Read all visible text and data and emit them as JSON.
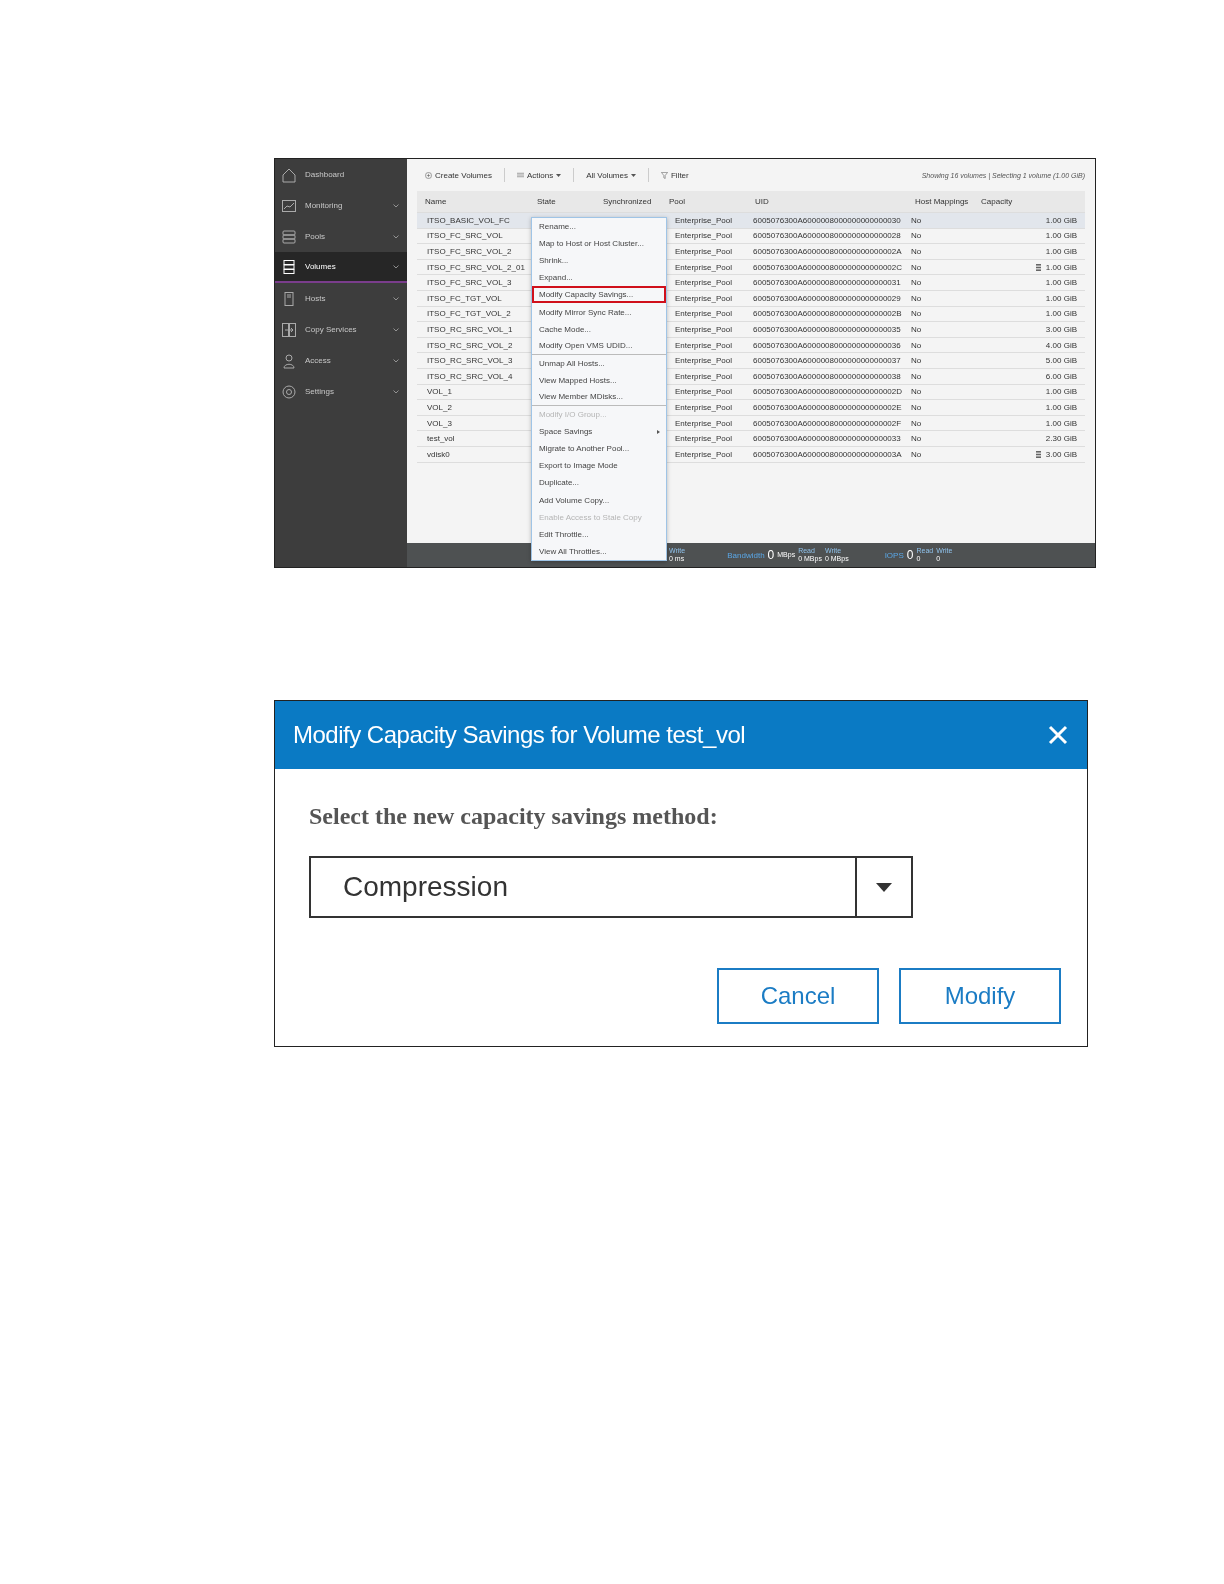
{
  "volumes_screen": {
    "sidebar": {
      "items": [
        {
          "label": "Dashboard",
          "selected": false,
          "expandable": false
        },
        {
          "label": "Monitoring",
          "selected": false,
          "expandable": true
        },
        {
          "label": "Pools",
          "selected": false,
          "expandable": true
        },
        {
          "label": "Volumes",
          "selected": true,
          "expandable": true
        },
        {
          "label": "Hosts",
          "selected": false,
          "expandable": true
        },
        {
          "label": "Copy Services",
          "selected": false,
          "expandable": true
        },
        {
          "label": "Access",
          "selected": false,
          "expandable": true
        },
        {
          "label": "Settings",
          "selected": false,
          "expandable": true
        }
      ]
    },
    "toolbar": {
      "create": "Create Volumes",
      "actions": "Actions",
      "filter_menu": "All Volumes",
      "filter": "Filter",
      "summary": "Showing 16 volumes | Selecting 1 volume (1.00 GiB)"
    },
    "table": {
      "columns": [
        "Name",
        "State",
        "Synchronized",
        "Pool",
        "UID",
        "Host Mappings",
        "Capacity"
      ],
      "rows": [
        {
          "name": "ITSO_BASIC_VOL_FC",
          "pool": "Enterprise_Pool",
          "uid": "6005076300A6000008000000000000030",
          "host_mappings": "No",
          "capacity": "1.00 GiB",
          "selected": true,
          "multi_copy": false
        },
        {
          "name": "ITSO_FC_SRC_VOL",
          "pool": "Enterprise_Pool",
          "uid": "6005076300A6000008000000000000028",
          "host_mappings": "No",
          "capacity": "1.00 GiB",
          "selected": false,
          "multi_copy": false
        },
        {
          "name": "ITSO_FC_SRC_VOL_2",
          "pool": "Enterprise_Pool",
          "uid": "6005076300A600000800000000000002A",
          "host_mappings": "No",
          "capacity": "1.00 GiB",
          "selected": false,
          "multi_copy": false
        },
        {
          "name": "ITSO_FC_SRC_VOL_2_01",
          "pool": "Enterprise_Pool",
          "uid": "6005076300A600000800000000000002C",
          "host_mappings": "No",
          "capacity": "1.00 GiB",
          "selected": false,
          "multi_copy": true
        },
        {
          "name": "ITSO_FC_SRC_VOL_3",
          "pool": "Enterprise_Pool",
          "uid": "6005076300A6000008000000000000031",
          "host_mappings": "No",
          "capacity": "1.00 GiB",
          "selected": false,
          "multi_copy": false
        },
        {
          "name": "ITSO_FC_TGT_VOL",
          "pool": "Enterprise_Pool",
          "uid": "6005076300A6000008000000000000029",
          "host_mappings": "No",
          "capacity": "1.00 GiB",
          "selected": false,
          "multi_copy": false
        },
        {
          "name": "ITSO_FC_TGT_VOL_2",
          "pool": "Enterprise_Pool",
          "uid": "6005076300A600000800000000000002B",
          "host_mappings": "No",
          "capacity": "1.00 GiB",
          "selected": false,
          "multi_copy": false
        },
        {
          "name": "ITSO_RC_SRC_VOL_1",
          "pool": "Enterprise_Pool",
          "uid": "6005076300A6000008000000000000035",
          "host_mappings": "No",
          "capacity": "3.00 GiB",
          "selected": false,
          "multi_copy": false
        },
        {
          "name": "ITSO_RC_SRC_VOL_2",
          "pool": "Enterprise_Pool",
          "uid": "6005076300A6000008000000000000036",
          "host_mappings": "No",
          "capacity": "4.00 GiB",
          "selected": false,
          "multi_copy": false
        },
        {
          "name": "ITSO_RC_SRC_VOL_3",
          "pool": "Enterprise_Pool",
          "uid": "6005076300A6000008000000000000037",
          "host_mappings": "No",
          "capacity": "5.00 GiB",
          "selected": false,
          "multi_copy": false
        },
        {
          "name": "ITSO_RC_SRC_VOL_4",
          "pool": "Enterprise_Pool",
          "uid": "6005076300A6000008000000000000038",
          "host_mappings": "No",
          "capacity": "6.00 GiB",
          "selected": false,
          "multi_copy": false
        },
        {
          "name": "VOL_1",
          "pool": "Enterprise_Pool",
          "uid": "6005076300A600000800000000000002D",
          "host_mappings": "No",
          "capacity": "1.00 GiB",
          "selected": false,
          "multi_copy": false
        },
        {
          "name": "VOL_2",
          "pool": "Enterprise_Pool",
          "uid": "6005076300A600000800000000000002E",
          "host_mappings": "No",
          "capacity": "1.00 GiB",
          "selected": false,
          "multi_copy": false
        },
        {
          "name": "VOL_3",
          "pool": "Enterprise_Pool",
          "uid": "6005076300A600000800000000000002F",
          "host_mappings": "No",
          "capacity": "1.00 GiB",
          "selected": false,
          "multi_copy": false
        },
        {
          "name": "test_vol",
          "pool": "Enterprise_Pool",
          "uid": "6005076300A6000008000000000000033",
          "host_mappings": "No",
          "capacity": "2.30 GiB",
          "selected": false,
          "multi_copy": false
        },
        {
          "name": "vdisk0",
          "pool": "Enterprise_Pool",
          "uid": "6005076300A600000800000000000003A",
          "host_mappings": "No",
          "capacity": "3.00 GiB",
          "selected": false,
          "multi_copy": true
        }
      ]
    },
    "context_menu": {
      "items": [
        {
          "label": "Rename...",
          "disabled": false,
          "highlighted": false,
          "submenu": false,
          "separator_after": false
        },
        {
          "label": "Map to Host or Host Cluster...",
          "disabled": false,
          "highlighted": false,
          "submenu": false,
          "separator_after": false
        },
        {
          "label": "Shrink...",
          "disabled": false,
          "highlighted": false,
          "submenu": false,
          "separator_after": false
        },
        {
          "label": "Expand...",
          "disabled": false,
          "highlighted": false,
          "submenu": false,
          "separator_after": false
        },
        {
          "label": "Modify Capacity Savings...",
          "disabled": false,
          "highlighted": true,
          "submenu": false,
          "separator_after": false
        },
        {
          "label": "Modify Mirror Sync Rate...",
          "disabled": false,
          "highlighted": false,
          "submenu": false,
          "separator_after": false
        },
        {
          "label": "Cache Mode...",
          "disabled": false,
          "highlighted": false,
          "submenu": false,
          "separator_after": false
        },
        {
          "label": "Modify Open VMS UDID...",
          "disabled": false,
          "highlighted": false,
          "submenu": false,
          "separator_after": true
        },
        {
          "label": "Unmap All Hosts...",
          "disabled": false,
          "highlighted": false,
          "submenu": false,
          "separator_after": false
        },
        {
          "label": "View Mapped Hosts...",
          "disabled": false,
          "highlighted": false,
          "submenu": false,
          "separator_after": false
        },
        {
          "label": "View Member MDisks...",
          "disabled": false,
          "highlighted": false,
          "submenu": false,
          "separator_after": true
        },
        {
          "label": "Modify I/O Group...",
          "disabled": true,
          "highlighted": false,
          "submenu": false,
          "separator_after": false
        },
        {
          "label": "Space Savings",
          "disabled": false,
          "highlighted": false,
          "submenu": true,
          "separator_after": false
        },
        {
          "label": "Migrate to Another Pool...",
          "disabled": false,
          "highlighted": false,
          "submenu": false,
          "separator_after": false
        },
        {
          "label": "Export to Image Mode",
          "disabled": false,
          "highlighted": false,
          "submenu": false,
          "separator_after": false
        },
        {
          "label": "Duplicate...",
          "disabled": false,
          "highlighted": false,
          "submenu": false,
          "separator_after": false
        },
        {
          "label": "Add Volume Copy...",
          "disabled": false,
          "highlighted": false,
          "submenu": false,
          "separator_after": false
        },
        {
          "label": "Enable Access to Stale Copy",
          "disabled": true,
          "highlighted": false,
          "submenu": false,
          "separator_after": false
        },
        {
          "label": "Edit Throttle...",
          "disabled": false,
          "highlighted": false,
          "submenu": false,
          "separator_after": false
        },
        {
          "label": "View All Throttles...",
          "disabled": false,
          "highlighted": false,
          "submenu": false,
          "separator_after": false
        }
      ]
    },
    "status_bar": {
      "latency": {
        "label": "Write",
        "value": "0 ms"
      },
      "bandwidth": {
        "label": "Bandwidth",
        "value": "0",
        "unit": "MBps",
        "read_label": "Read",
        "read": "0 MBps",
        "write_label": "Write",
        "write": "0 MBps"
      },
      "iops": {
        "label": "IOPS",
        "value": "0",
        "read_label": "Read",
        "read": "0",
        "write_label": "Write",
        "write": "0"
      }
    }
  },
  "dialog": {
    "title": "Modify Capacity Savings for Volume test_vol",
    "prompt": "Select the new capacity savings method:",
    "method": {
      "value": "Compression"
    },
    "buttons": [
      "Cancel",
      "Modify"
    ]
  }
}
